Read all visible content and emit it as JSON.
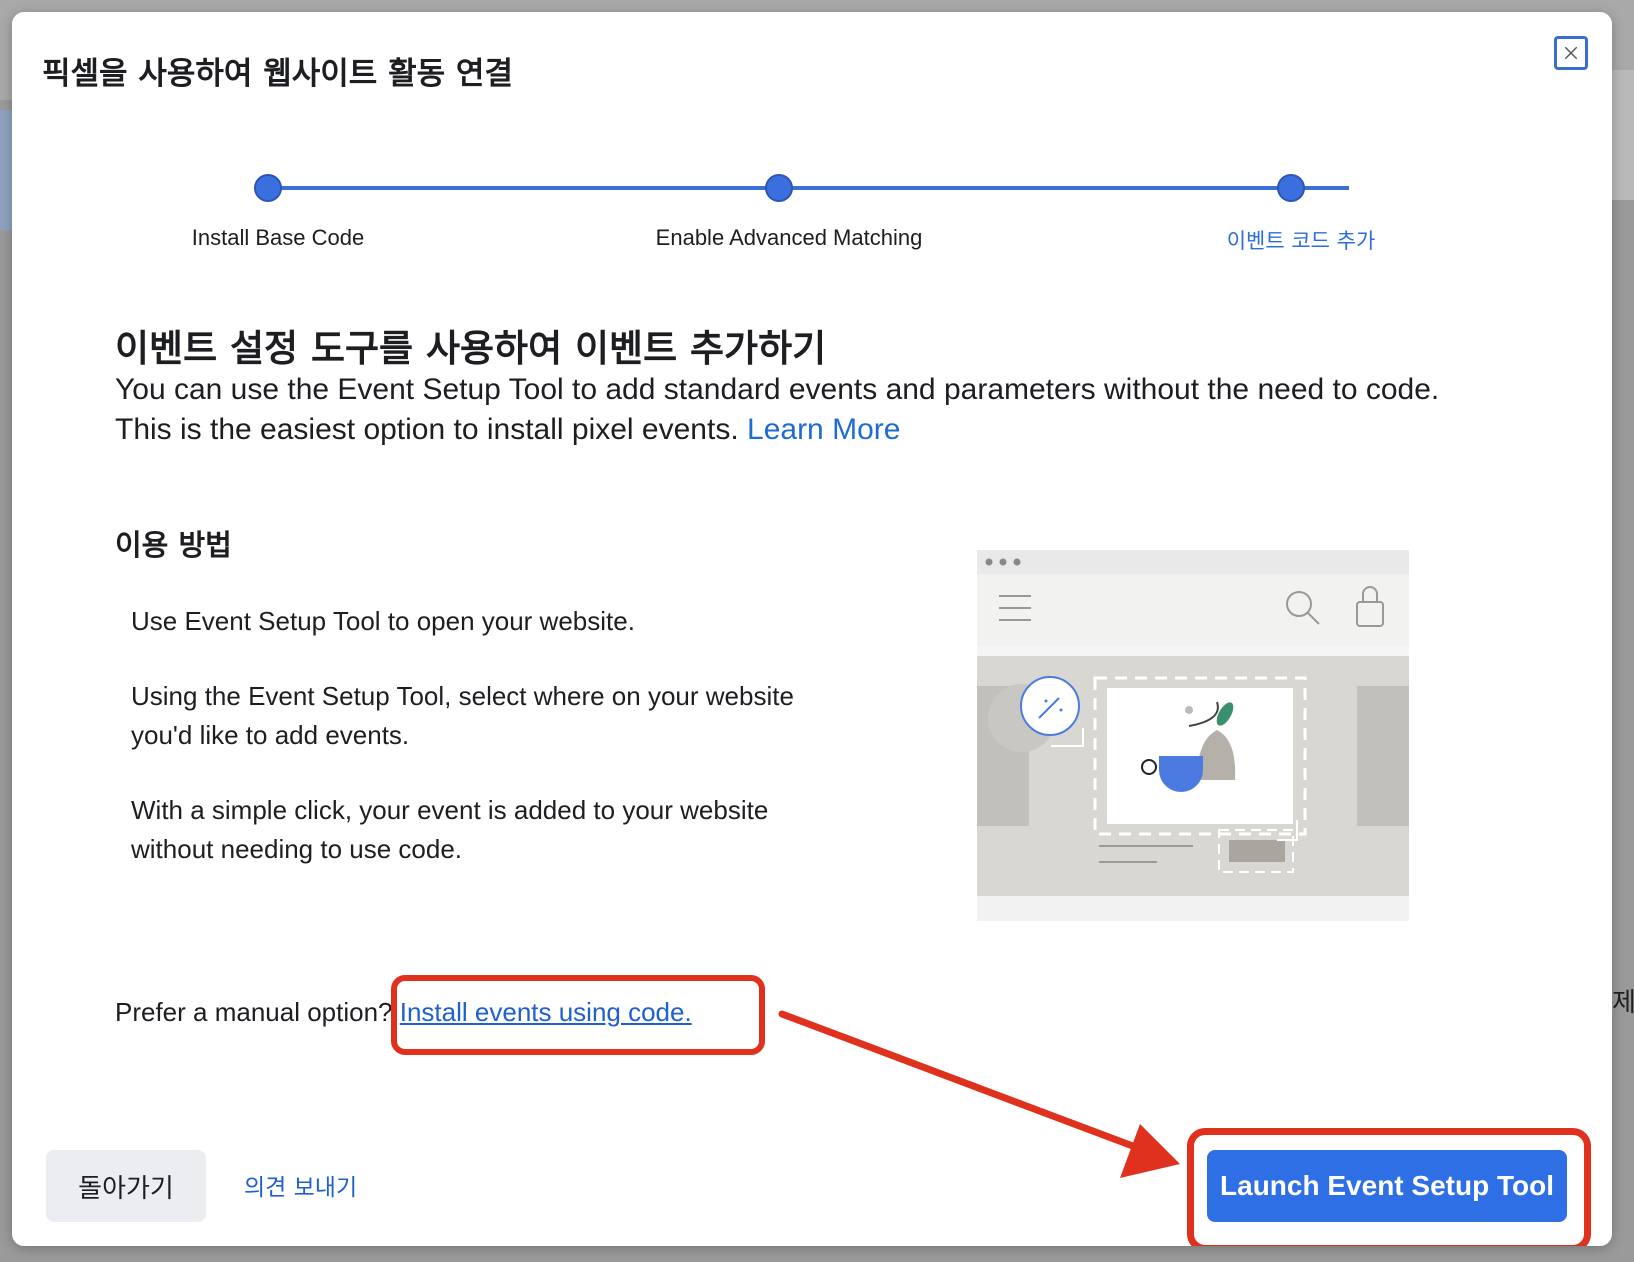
{
  "modal": {
    "title": "픽셀을 사용하여 웹사이트 활동 연결",
    "close_icon": "close-icon"
  },
  "stepper": {
    "steps": [
      {
        "label": "Install Base Code",
        "state": "complete"
      },
      {
        "label": "Enable Advanced Matching",
        "state": "complete"
      },
      {
        "label": "이벤트 코드 추가",
        "state": "current"
      }
    ]
  },
  "content": {
    "heading": "이벤트 설정 도구를 사용하여 이벤트 추가하기",
    "description": "You can use the Event Setup Tool to add standard events and parameters without the need to code. This is the easiest option to install pixel events.",
    "learn_more": "Learn More",
    "howto_title": "이용 방법",
    "howto_steps": [
      "Use Event Setup Tool to open your website.",
      "Using the Event Setup Tool, select where on your website you'd like to add events.",
      "With a simple click, your event is added to your website without needing to use code."
    ],
    "manual_prefix": "Prefer a manual option?",
    "manual_link": "Install events using code."
  },
  "footer": {
    "back_label": "돌아가기",
    "feedback_label": "의견 보내기",
    "launch_label": "Launch Event Setup Tool"
  },
  "backdrop": {
    "edge_char": "제"
  },
  "colors": {
    "accent_blue": "#2f6fe6",
    "link_blue": "#1f5fcf",
    "annotation_red": "#e0311f"
  }
}
